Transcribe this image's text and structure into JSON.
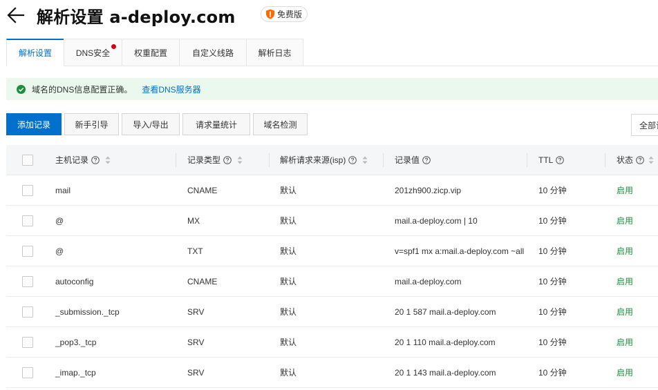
{
  "header": {
    "title": "解析设置 a-deploy.com",
    "badge": "免费版"
  },
  "tabs": [
    {
      "label": "解析设置",
      "active": true
    },
    {
      "label": "DNS安全",
      "dot": true
    },
    {
      "label": "权重配置"
    },
    {
      "label": "自定义线路"
    },
    {
      "label": "解析日志"
    }
  ],
  "alert": {
    "message": "域名的DNS信息配置正确。",
    "link": "查看DNS服务器"
  },
  "toolbar": {
    "add": "添加记录",
    "guide": "新手引导",
    "import_export": "导入/导出",
    "stats": "请求量统计",
    "check": "域名检测",
    "right": "全部记录"
  },
  "table": {
    "headers": {
      "host": "主机记录",
      "type": "记录类型",
      "isp": "解析请求来源(isp)",
      "value": "记录值",
      "ttl": "TTL",
      "status": "状态"
    },
    "rows": [
      {
        "host": "mail",
        "type": "CNAME",
        "isp": "默认",
        "value": "201zh900.zicp.vip",
        "ttl": "10 分钟",
        "status": "启用"
      },
      {
        "host": "@",
        "type": "MX",
        "isp": "默认",
        "value": "mail.a-deploy.com | 10",
        "ttl": "10 分钟",
        "status": "启用"
      },
      {
        "host": "@",
        "type": "TXT",
        "isp": "默认",
        "value": "v=spf1 mx a:mail.a-deploy.com ~all",
        "ttl": "10 分钟",
        "status": "启用"
      },
      {
        "host": "autoconfig",
        "type": "CNAME",
        "isp": "默认",
        "value": "mail.a-deploy.com",
        "ttl": "10 分钟",
        "status": "启用"
      },
      {
        "host": "_submission._tcp",
        "type": "SRV",
        "isp": "默认",
        "value": "20 1 587 mail.a-deploy.com",
        "ttl": "10 分钟",
        "status": "启用"
      },
      {
        "host": "_pop3._tcp",
        "type": "SRV",
        "isp": "默认",
        "value": "20 1 110 mail.a-deploy.com",
        "ttl": "10 分钟",
        "status": "启用"
      },
      {
        "host": "_imap._tcp",
        "type": "SRV",
        "isp": "默认",
        "value": "20 1 143 mail.a-deploy.com",
        "ttl": "10 分钟",
        "status": "启用"
      }
    ]
  },
  "colors": {
    "primary": "#0070cc",
    "success": "#1e8e3e",
    "alert_bg": "#ebf8ee",
    "tab_dot": "#d0021b"
  }
}
